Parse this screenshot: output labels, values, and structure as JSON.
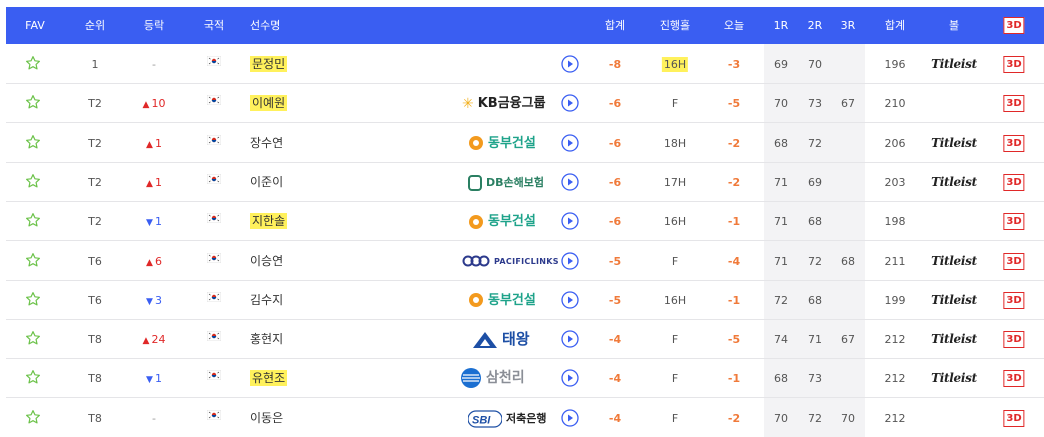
{
  "header": {
    "fav": "FAV",
    "rank": "순위",
    "move": "등락",
    "nation": "국적",
    "player": "선수명",
    "score": "합계",
    "thru": "진행홀",
    "today": "오늘",
    "r1": "1R",
    "r2": "2R",
    "r3": "3R",
    "total": "합계",
    "ball": "볼",
    "view3d": "3D"
  },
  "colors": {
    "header_bg": "#3a5ef2",
    "score_orange": "#f07a3a",
    "move_up": "#e02828",
    "move_down": "#3a5ef2",
    "highlight": "#fff15c",
    "badge_3d": "#e02828"
  },
  "players": [
    {
      "rank": "1",
      "move_dir": "none",
      "move": "-",
      "flag": "south-korea-flag",
      "name": "문정민",
      "highlight_name": true,
      "sponsor": "",
      "score": "-8",
      "thru": "16H",
      "highlight_thru": true,
      "today": "-3",
      "r1": "69",
      "r2": "70",
      "r3": "",
      "total": "196",
      "ball": "Titleist",
      "view3d": "3D"
    },
    {
      "rank": "T2",
      "move_dir": "up",
      "move": "10",
      "flag": "south-korea-flag",
      "name": "이예원",
      "highlight_name": true,
      "sponsor": "KB금융그룹",
      "score": "-6",
      "thru": "F",
      "highlight_thru": false,
      "today": "-5",
      "r1": "70",
      "r2": "73",
      "r3": "67",
      "total": "210",
      "ball": "",
      "view3d": "3D"
    },
    {
      "rank": "T2",
      "move_dir": "up",
      "move": "1",
      "flag": "south-korea-flag",
      "name": "장수연",
      "highlight_name": false,
      "sponsor": "동부건설",
      "score": "-6",
      "thru": "18H",
      "highlight_thru": false,
      "today": "-2",
      "r1": "68",
      "r2": "72",
      "r3": "",
      "total": "206",
      "ball": "Titleist",
      "view3d": "3D"
    },
    {
      "rank": "T2",
      "move_dir": "up",
      "move": "1",
      "flag": "south-korea-flag",
      "name": "이준이",
      "highlight_name": false,
      "sponsor": "DB손해보험",
      "score": "-6",
      "thru": "17H",
      "highlight_thru": false,
      "today": "-2",
      "r1": "71",
      "r2": "69",
      "r3": "",
      "total": "203",
      "ball": "Titleist",
      "view3d": "3D"
    },
    {
      "rank": "T2",
      "move_dir": "down",
      "move": "1",
      "flag": "south-korea-flag",
      "name": "지한솔",
      "highlight_name": true,
      "sponsor": "동부건설",
      "score": "-6",
      "thru": "16H",
      "highlight_thru": false,
      "today": "-1",
      "r1": "71",
      "r2": "68",
      "r3": "",
      "total": "198",
      "ball": "",
      "view3d": "3D"
    },
    {
      "rank": "T6",
      "move_dir": "up",
      "move": "6",
      "flag": "south-korea-flag",
      "name": "이승연",
      "highlight_name": false,
      "sponsor": "PACIFICLINKS",
      "score": "-5",
      "thru": "F",
      "highlight_thru": false,
      "today": "-4",
      "r1": "71",
      "r2": "72",
      "r3": "68",
      "total": "211",
      "ball": "Titleist",
      "view3d": "3D"
    },
    {
      "rank": "T6",
      "move_dir": "down",
      "move": "3",
      "flag": "south-korea-flag",
      "name": "김수지",
      "highlight_name": false,
      "sponsor": "동부건설",
      "score": "-5",
      "thru": "16H",
      "highlight_thru": false,
      "today": "-1",
      "r1": "72",
      "r2": "68",
      "r3": "",
      "total": "199",
      "ball": "Titleist",
      "view3d": "3D"
    },
    {
      "rank": "T8",
      "move_dir": "up",
      "move": "24",
      "flag": "south-korea-flag",
      "name": "홍현지",
      "highlight_name": false,
      "sponsor": "태왕",
      "score": "-4",
      "thru": "F",
      "highlight_thru": false,
      "today": "-5",
      "r1": "74",
      "r2": "71",
      "r3": "67",
      "total": "212",
      "ball": "Titleist",
      "view3d": "3D"
    },
    {
      "rank": "T8",
      "move_dir": "down",
      "move": "1",
      "flag": "south-korea-flag",
      "name": "유현조",
      "highlight_name": true,
      "sponsor": "삼천리",
      "score": "-4",
      "thru": "F",
      "highlight_thru": false,
      "today": "-1",
      "r1": "68",
      "r2": "73",
      "r3": "",
      "total": "212",
      "ball": "Titleist",
      "view3d": "3D"
    },
    {
      "rank": "T8",
      "move_dir": "none",
      "move": "-",
      "flag": "south-korea-flag",
      "name": "이동은",
      "highlight_name": false,
      "sponsor": "저축은행",
      "score": "-4",
      "thru": "F",
      "highlight_thru": false,
      "today": "-2",
      "r1": "70",
      "r2": "72",
      "r3": "70",
      "total": "212",
      "ball": "",
      "view3d": "3D"
    }
  ]
}
